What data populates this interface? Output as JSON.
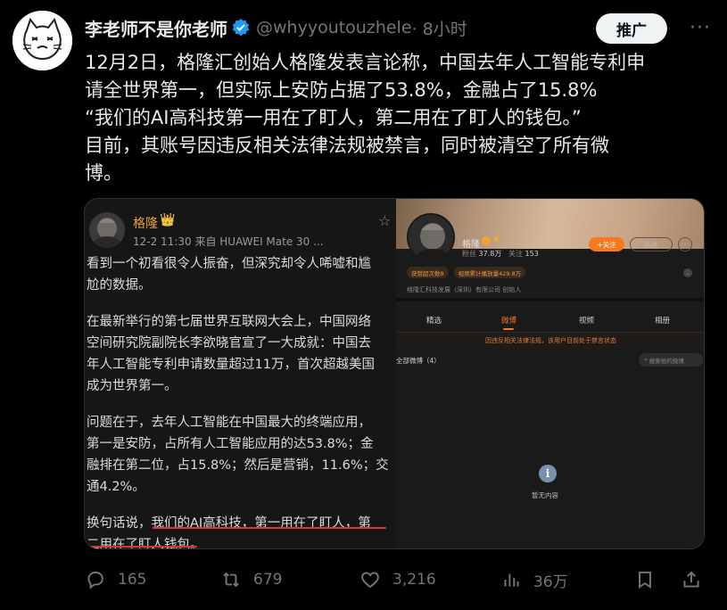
{
  "author": {
    "name": "李老师不是你老师",
    "handle": "@whyyoutouzhele",
    "time": "· 8小时"
  },
  "promote_label": "推广",
  "more_label": "···",
  "tweet_lines": [
    "12月2日，格隆汇创始人格隆发表言论称，中国去年人工智能专利申",
    "请全世界第一，但实际上安防占据了53.8%，金融占了15.8%",
    "“我们的AI高科技第一用在了盯人，第二用在了盯人的钱包。”",
    "目前，其账号因违反相关法律法规被禁言，同时被清空了所有微",
    "博。"
  ],
  "embedded_post": {
    "name": "格隆",
    "crown": "👑",
    "meta": "12-2 11:30  来自 HUAWEI Mate 30 ...",
    "star": "☆",
    "paragraphs": [
      [
        "看到一个初看很令人振奋，但深究却令人唏嘘和尴",
        "尬的数据。"
      ],
      [
        "在最新举行的第七届世界互联网大会上，中国网络",
        "空间研究院副院长李欲晓官宣了一大成就：中国去",
        "年人工智能专利申请数量超过11万，首次超越美国",
        "成为世界第一。"
      ],
      [
        "问题在于，去年人工智能在中国最大的终端应用，",
        "第一是安防，占所有人工智能应用的达53.8%；金",
        "融排在第二位，占15.8%；然后是营销，11.6%；交",
        "通4.2%。"
      ],
      [
        "换句话说，我们的AI高科技，第一用在了盯人，第",
        "二用在了盯人钱包。"
      ]
    ]
  },
  "profile_screenshot": {
    "name": "格隆",
    "fans_label": "粉丝",
    "fans_value": "37.8万",
    "follow_label": "关注",
    "follow_value": "153",
    "follow_button": "+关注",
    "message_button": "私信",
    "more_button": "···",
    "badges": [
      "获赞超次数8",
      "视频累计播放量429.8万"
    ],
    "company": "格隆汇科技发展（深圳）有限公司 创始人",
    "tabs": [
      "精选",
      "微博",
      "视频",
      "相册"
    ],
    "active_tab": "微博",
    "notice": "因违反相关法律法规，该用户目前处于禁言状态",
    "feed_title": "全部微博（4）",
    "search_placeholder": "搜索他的微博",
    "empty_text": "暂无内容"
  },
  "actions": {
    "replies": "165",
    "reposts": "679",
    "likes": "3,216",
    "views": "36万"
  },
  "colors": {
    "background": "#000000",
    "text": "#e7e9ea",
    "muted": "#71767b",
    "verified": "#1d9bf0",
    "weibo_orange": "#f47920",
    "underline_red": "#d6392f"
  }
}
